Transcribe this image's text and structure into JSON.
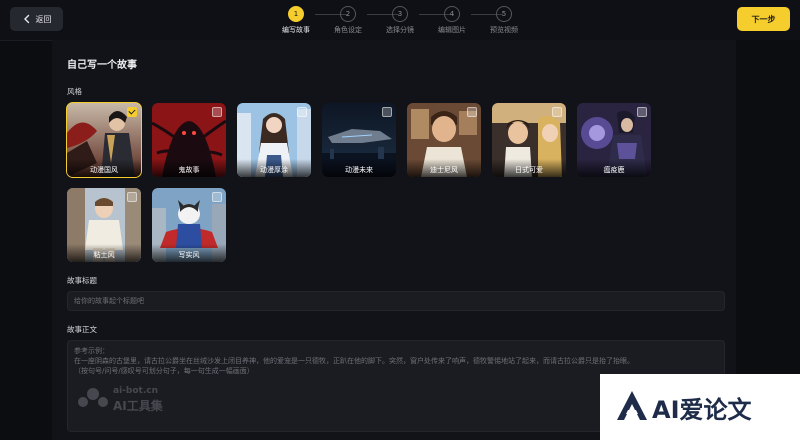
{
  "header": {
    "back_label": "返回",
    "next_label": "下一步",
    "steps": [
      {
        "num": "1",
        "label": "编写故事",
        "active": true
      },
      {
        "num": "2",
        "label": "角色设定",
        "active": false
      },
      {
        "num": "3",
        "label": "选择分镜",
        "active": false
      },
      {
        "num": "4",
        "label": "编辑图片",
        "active": false
      },
      {
        "num": "5",
        "label": "预览视频",
        "active": false
      }
    ]
  },
  "main": {
    "title": "自己写一个故事",
    "style_label": "风格",
    "styles": [
      {
        "label": "动漫国风",
        "selected": true
      },
      {
        "label": "鬼故事",
        "selected": false
      },
      {
        "label": "动漫厚涂",
        "selected": false
      },
      {
        "label": "动漫未来",
        "selected": false
      },
      {
        "label": "迪士尼风",
        "selected": false
      },
      {
        "label": "日式可爱",
        "selected": false
      },
      {
        "label": "瘟疫鹿",
        "selected": false
      },
      {
        "label": "粘土风",
        "selected": false
      },
      {
        "label": "写实风",
        "selected": false
      }
    ],
    "story_title_label": "故事标题",
    "story_title_placeholder": "给你的故事起个标题吧",
    "story_body_label": "故事正文",
    "story_body_placeholder_lines": [
      "参考示例：",
      "在一座阴森的古堡里，请古拉公爵坐在丝绒沙发上闭目养神，他的爱宠是一只德牧，正趴在他的脚下。突然，窗户处传来了响声，德牧警惕地站了起来，而请古拉公爵只是抬了抬眼。",
      "（按句号/问号/感叹号可划分句子，每一句生成一幅画面）"
    ]
  },
  "watermarks": {
    "site_domain": "ai-bot.cn",
    "site_name": "AI工具集",
    "brand": "AI爱论文"
  },
  "colors": {
    "accent": "#f5cd2c",
    "background": "#0c0d11",
    "panel": "#121318"
  }
}
